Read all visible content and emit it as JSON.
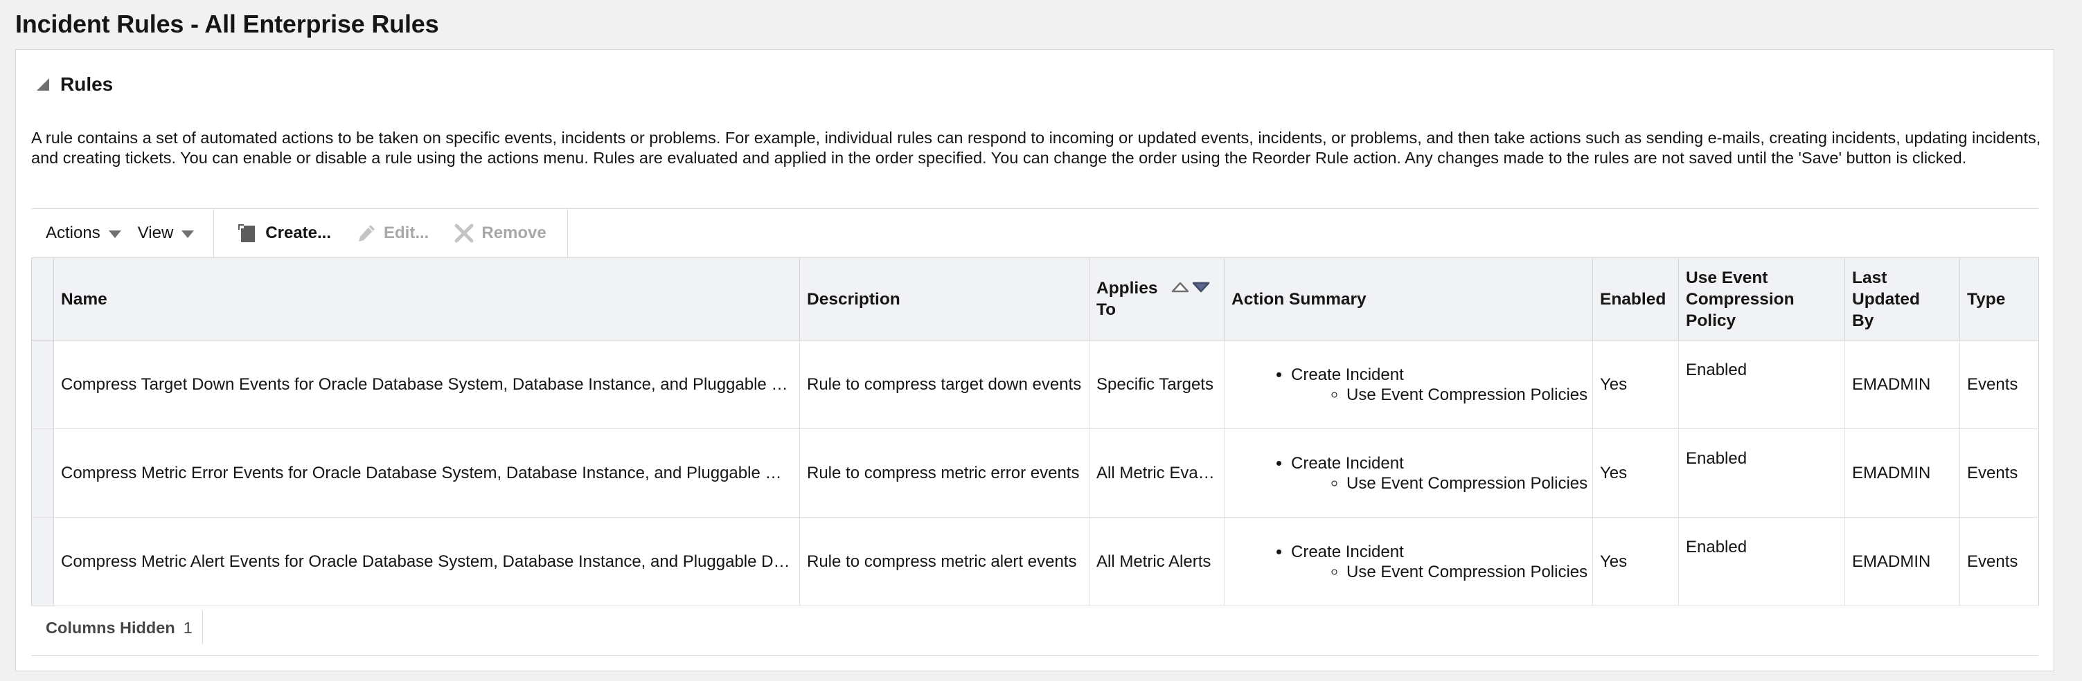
{
  "page": {
    "title": "Incident Rules - All Enterprise Rules"
  },
  "section": {
    "title": "Rules",
    "expanded": true,
    "description": "A rule contains a set of automated actions to be taken on specific events, incidents or problems. For example, individual rules can respond to incoming or updated events, incidents, or problems, and then take actions such as sending e-mails, creating incidents, updating incidents, and creating tickets. You can enable or disable a rule using the actions menu. Rules are evaluated and applied in the order specified. You can change the order using the Reorder Rule action. Any changes made to the rules are not saved until the 'Save' button is clicked."
  },
  "toolbar": {
    "actions_label": "Actions",
    "view_label": "View",
    "create_label": "Create...",
    "edit_label": "Edit...",
    "remove_label": "Remove"
  },
  "table": {
    "columns": {
      "name": "Name",
      "description": "Description",
      "applies_to_line1": "Applies",
      "applies_to_line2": "To",
      "action_summary": "Action Summary",
      "enabled": "Enabled",
      "compression_line1": "Use Event",
      "compression_line2": "Compression",
      "compression_line3": "Policy",
      "updated_line1": "Last",
      "updated_line2": "Updated",
      "updated_line3": "By",
      "type": "Type"
    },
    "rows": [
      {
        "name": "Compress Target Down Events for Oracle Database System, Database Instance, and Pluggable Database",
        "description": "Rule to compress target down events",
        "applies_to": "Specific Targets",
        "action": "Create Incident",
        "sub_action": "Use Event Compression Policies",
        "enabled": "Yes",
        "compression": "Enabled",
        "updated_by": "EMADMIN",
        "type": "Events"
      },
      {
        "name": "Compress Metric Error Events for Oracle Database System, Database Instance, and Pluggable Database",
        "description": "Rule to compress metric error events",
        "applies_to": "All Metric Evaluation Errors",
        "action": "Create Incident",
        "sub_action": "Use Event Compression Policies",
        "enabled": "Yes",
        "compression": "Enabled",
        "updated_by": "EMADMIN",
        "type": "Events"
      },
      {
        "name": "Compress Metric Alert Events for Oracle Database System, Database Instance, and Pluggable Database",
        "description": "Rule to compress metric alert events",
        "applies_to": "All Metric Alerts",
        "action": "Create Incident",
        "sub_action": "Use Event Compression Policies",
        "enabled": "Yes",
        "compression": "Enabled",
        "updated_by": "EMADMIN",
        "type": "Events"
      }
    ]
  },
  "footer": {
    "columns_hidden_label": "Columns Hidden",
    "columns_hidden_count": "1"
  },
  "icons": {
    "section_toggle": "triangle-expanded-icon",
    "dropdown": "caret-down-icon",
    "create": "document-new-icon",
    "edit": "pencil-icon",
    "remove": "x-icon",
    "sort": "sort-asc-desc-icon"
  },
  "colors": {
    "header_bg": "#f1f2f6",
    "disabled_text": "#a8a8a8",
    "sort_desc_active": "#5b6a8c"
  }
}
